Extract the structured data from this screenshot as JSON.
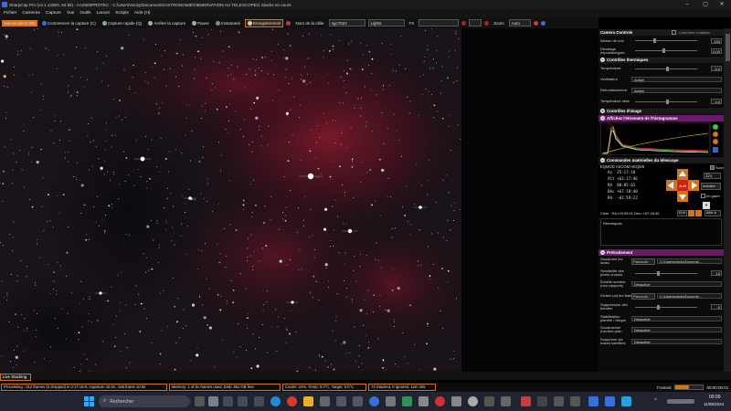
{
  "window": {
    "title": "SharpCap Pro (v4.1.13300, 64 bit) - AA2600PROTEC - C:\\Users\\micky\\Documents\\ASTRONOMIE\\OBSERVATION AU TELESCOPE\\1 Stacks en cours",
    "minimize": "–",
    "maximize": "▢",
    "close": "✕"
  },
  "menu": [
    "Fichier",
    "Cameras",
    "Capture",
    "Vue",
    "Outils",
    "Lancer",
    "Scripts",
    "Aide (H)"
  ],
  "toolbar": {
    "live_view": "Vue en direct (W)",
    "start_capture": "Commencer la capture (C)",
    "quick_capture": "Capture rapide (Q)",
    "stop_capture": "Arrêter la capture",
    "pause": "Pause",
    "snapshot": "Instantané",
    "save": "Enregistrement",
    "target_label": "Nom de la cible",
    "target_value": "ngc7822",
    "frame_type": "Lights",
    "fx_label": "FX",
    "zoom_label": "Zoom",
    "zoom_value": "Auto"
  },
  "panel": {
    "camera_controls": "Camera Controls",
    "advanced_checkbox": "Contrôles multiples",
    "rows_top": [
      {
        "label": "Niveau de noir",
        "value": "150"
      },
      {
        "label": "Décalage exposition/gain",
        "value": "0.00"
      }
    ],
    "thermal_title": "Contrôles thermiques",
    "thermal_rows": [
      {
        "label": "Température",
        "value": "0.0"
      },
      {
        "label": "Ventilateur",
        "dropdown": "Activé"
      },
      {
        "label": "Refroidissement",
        "dropdown": "Activé"
      },
      {
        "label": "Température cible",
        "value": "0.0"
      }
    ],
    "image_title": "Contrôles d'image",
    "histo_title": "Affichez l'étirement de l'histogramme",
    "scope_title": "Commandes matérielles du télescope",
    "scope_name": "EQMOD ASCOM HEQ5/6",
    "scope_lines": [
      {
        "k": "Az",
        "v": "25:17:18"
      },
      {
        "k": "Alt",
        "v": "+63:17:46"
      },
      {
        "k": "RA",
        "v": "00:05:01"
      },
      {
        "k": "Déc",
        "v": "+67:18:40"
      },
      {
        "k": "RA",
        "v": "-01:59:22"
      }
    ],
    "scope_track": "Suivi",
    "scope_rate": "32x",
    "scope_install": "Installer",
    "scope_guide": "en garer",
    "scope_center": "Arrêt",
    "scope_target": "Cible : RA=00:05:01 Dec=+67:18:40",
    "scope_enter": "Entr",
    "scope_goto": "Aller à",
    "remarks": "Remarques",
    "preproc_title": "Prétraitement",
    "preproc_rows": [
      {
        "label": "Soustraire les darks",
        "button": "Parcourir",
        "path": "C:\\Users\\micky\\Docume..."
      },
      {
        "label": "Sensibilité des pixels chauds",
        "value": "10"
      },
      {
        "label": "Échelle sombre (noir rapports)",
        "dropdown": "Désactivé"
      },
      {
        "label": "Diviser par les flats",
        "button": "Parcourir",
        "path": "C:\\Users\\micky\\Docume..."
      },
      {
        "label": "Suppression des bandes",
        "value": "0"
      },
      {
        "label": "Stabilisation planète / disque",
        "dropdown": "Désactivé"
      },
      {
        "label": "Soustraction d'arrière-plan",
        "dropdown": "Désactivé"
      },
      {
        "label": "Supprimer les traces satellites",
        "dropdown": "Désactivé"
      }
    ]
  },
  "live_tab": "Live Stacking",
  "status": {
    "processing": "Processing ; 012 frames (0 dropped) in 2:17:16.9, exposure 10.0s , last frame 10.0s",
    "memory": "Memory: 1 of 51 frames used, Disk: 361 GB free",
    "cooler": "Cooler: 24%, Temp: 0.0°C, Target: 0.0°C",
    "stacked": "74 Stacked, 0 Ignored, 12m 20s",
    "frames_label": "Frames:",
    "progress": 0.5,
    "elapsed": "00:00:00:01"
  },
  "taskbar": {
    "search_placeholder": "Rechercher",
    "time": "00:09",
    "date": "11/09/2024"
  },
  "colors": {
    "accent": "#d4731e",
    "magenta": "#6a1b6a"
  }
}
